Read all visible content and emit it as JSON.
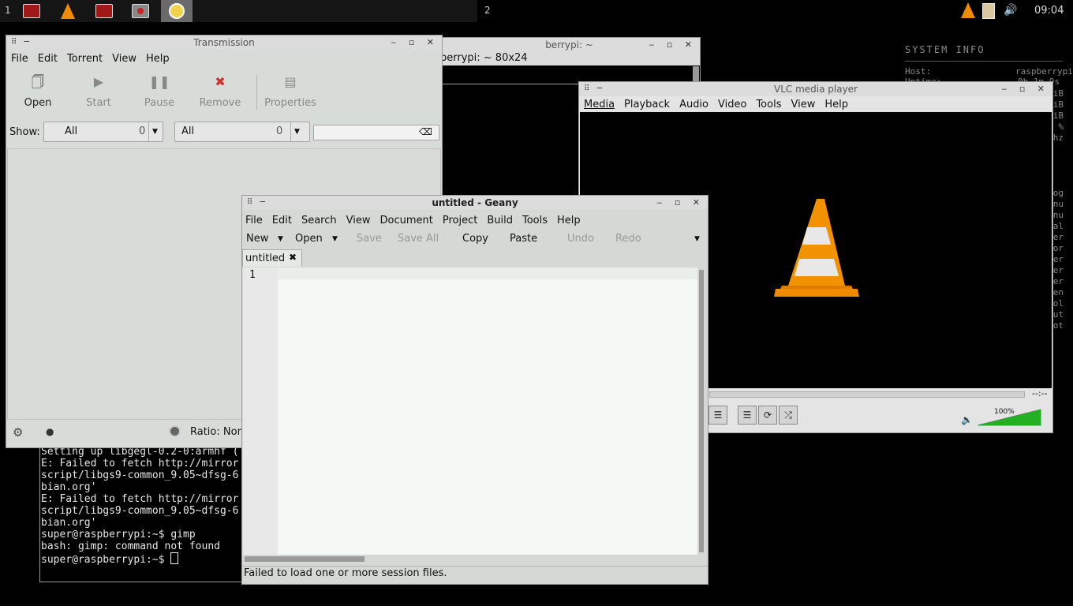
{
  "taskbar": {
    "workspace1": "1",
    "workspace2": "2",
    "clock": "09:04",
    "buttons": [
      "terminal-icon",
      "vlc-icon",
      "terminal-icon",
      "transmission-icon",
      "geany-icon"
    ]
  },
  "conky": {
    "header": "SYSTEM INFO",
    "host_label": "Host:",
    "host_value": "raspberrypi",
    "uptime_label": "Uptime:",
    "uptime_value": "0h 1m 9s",
    "right_fragments": [
      "iB",
      "iB",
      "iB",
      "%",
      "hz",
      "og",
      "nu",
      "nu",
      "nal",
      "ner",
      "tor",
      "ver",
      "ser",
      "ser",
      "en",
      "rol",
      "out",
      "hot"
    ]
  },
  "terminal": {
    "title": "berrypi: ~",
    "size_label": "berrypi: ~ 80x24",
    "lines": [
      "Setting up libgegl-0.2-0:armhf (",
      "E: Failed to fetch http://mirror",
      "script/libgs9-common_9.05~dfsg-6",
      "bian.org'",
      "",
      "E: Failed to fetch http://mirror",
      "script/libgs9-common_9.05~dfsg-6",
      "bian.org'",
      "super@raspberrypi:~$ gimp",
      "bash: gimp: command not found",
      "super@raspberrypi:~$ "
    ]
  },
  "transmission": {
    "title": "Transmission",
    "menu": [
      "File",
      "Edit",
      "Torrent",
      "View",
      "Help"
    ],
    "toolbar": {
      "open": "Open",
      "start": "Start",
      "pause": "Pause",
      "remove": "Remove",
      "properties": "Properties"
    },
    "filter": {
      "show_label": "Show:",
      "activity": "All",
      "activity_count": "0",
      "tracker": "All",
      "tracker_count": "0",
      "search_value": ""
    },
    "status": {
      "ratio": "Ratio: Non"
    }
  },
  "geany": {
    "title": "untitled - Geany",
    "menu": [
      "File",
      "Edit",
      "Search",
      "View",
      "Document",
      "Project",
      "Build",
      "Tools",
      "Help"
    ],
    "toolbar": {
      "new": "New",
      "open": "Open",
      "save": "Save",
      "save_all": "Save All",
      "copy": "Copy",
      "paste": "Paste",
      "undo": "Undo",
      "redo": "Redo"
    },
    "tab": "untitled",
    "line_number": "1",
    "status": "Failed to load one or more session files."
  },
  "vlc": {
    "title": "VLC media player",
    "menu": [
      "Media",
      "Playback",
      "Audio",
      "Video",
      "Tools",
      "View",
      "Help"
    ],
    "time": "--:--",
    "volume": "100%",
    "volume_level": 1.0
  },
  "colors": {
    "desktop": "#000000",
    "vlc_orange": "#f08a00",
    "volume_green": "#22b022"
  }
}
